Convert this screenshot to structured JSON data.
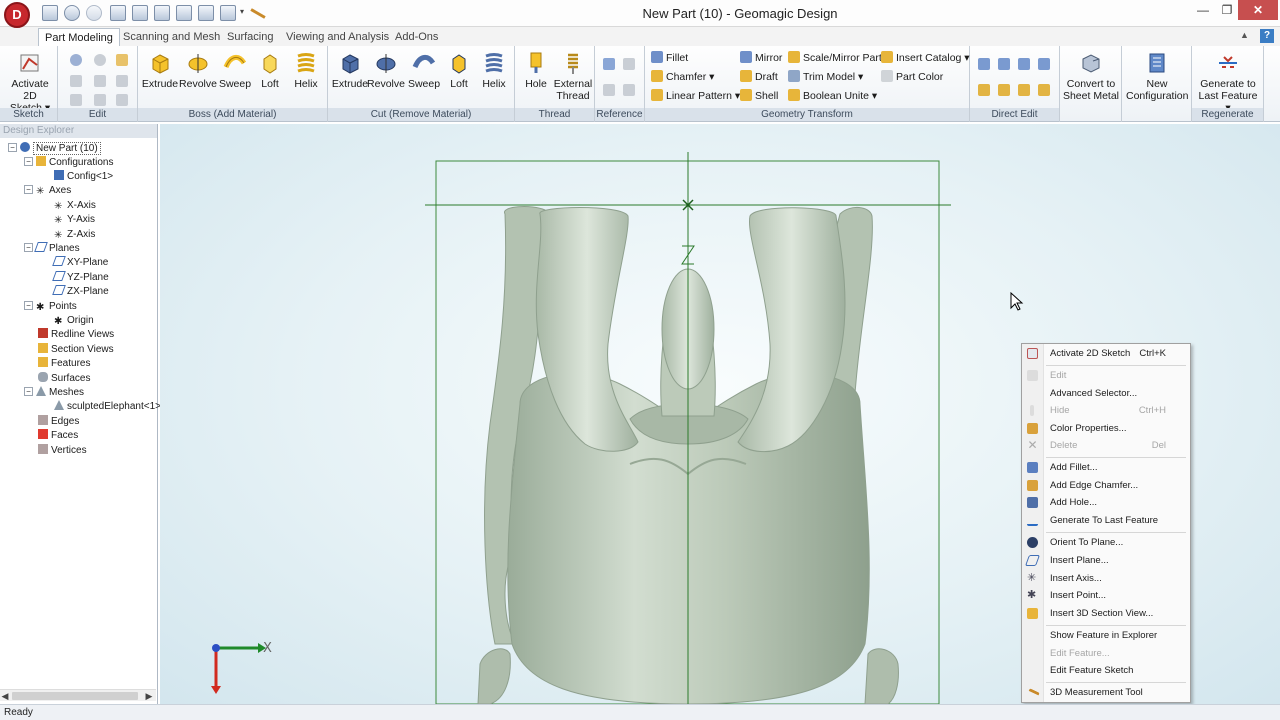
{
  "window": {
    "title": "New Part (10) - Geomagic Design"
  },
  "app_logo": {
    "letter": "D"
  },
  "tabs": [
    "Part Modeling",
    "Scanning and Mesh",
    "Surfacing",
    "Viewing and Analysis",
    "Add-Ons"
  ],
  "ribbon": {
    "groups": {
      "sketch": "Sketch",
      "edit": "Edit",
      "boss": "Boss (Add Material)",
      "cut": "Cut (Remove Material)",
      "thread": "Thread",
      "reference": "Reference",
      "geometry": "Geometry Transform",
      "direct_edit": "Direct Edit",
      "regenerate": "Regenerate"
    },
    "activate_sketch": [
      "Activate",
      "2D Sketch ▾"
    ],
    "boss": [
      "Extrude",
      "Revolve",
      "Sweep",
      "Loft",
      "Helix"
    ],
    "cut": [
      "Extrude",
      "Revolve",
      "Sweep",
      "Loft",
      "Helix"
    ],
    "thread": [
      "Hole",
      "External",
      "Thread"
    ],
    "geometry": {
      "fillet": "Fillet",
      "chamfer": "Chamfer ▾",
      "linear_pattern": "Linear Pattern ▾",
      "mirror": "Mirror",
      "draft": "Draft",
      "shell": "Shell",
      "scale_mirror": "Scale/Mirror Part",
      "trim_model": "Trim Model ▾",
      "boolean_unite": "Boolean Unite ▾",
      "insert_catalog": "Insert Catalog ▾",
      "part_color": "Part Color"
    },
    "convert": [
      "Convert to",
      "Sheet Metal"
    ],
    "new_config": [
      "New",
      "Configuration"
    ],
    "generate": [
      "Generate to",
      "Last Feature ▾"
    ]
  },
  "explorer": {
    "title": "Design Explorer",
    "root": "New Part (10)",
    "nodes": [
      "Configurations",
      "Config<1>",
      "Axes",
      "X-Axis",
      "Y-Axis",
      "Z-Axis",
      "Planes",
      "XY-Plane",
      "YZ-Plane",
      "ZX-Plane",
      "Points",
      "Origin",
      "Redline Views",
      "Section Views",
      "Features",
      "Surfaces",
      "Meshes",
      "sculptedElephant<1>",
      "Edges",
      "Faces",
      "Vertices"
    ]
  },
  "triad": {
    "x_label": "X"
  },
  "context_menu": {
    "items": [
      {
        "label": "Activate 2D Sketch",
        "shortcut": "Ctrl+K",
        "enabled": true
      },
      {
        "label": "Edit",
        "shortcut": "",
        "enabled": false
      },
      {
        "label": "Advanced Selector...",
        "shortcut": "",
        "enabled": true
      },
      {
        "label": "Hide",
        "shortcut": "Ctrl+H",
        "enabled": false
      },
      {
        "label": "Color Properties...",
        "shortcut": "",
        "enabled": true
      },
      {
        "label": "Delete",
        "shortcut": "Del",
        "enabled": false
      },
      {
        "label": "Add Fillet...",
        "shortcut": "",
        "enabled": true
      },
      {
        "label": "Add Edge Chamfer...",
        "shortcut": "",
        "enabled": true
      },
      {
        "label": "Add Hole...",
        "shortcut": "",
        "enabled": true
      },
      {
        "label": "Generate To Last Feature",
        "shortcut": "",
        "enabled": true
      },
      {
        "label": "Orient To Plane...",
        "shortcut": "",
        "enabled": true
      },
      {
        "label": "Insert Plane...",
        "shortcut": "",
        "enabled": true
      },
      {
        "label": "Insert Axis...",
        "shortcut": "",
        "enabled": true
      },
      {
        "label": "Insert Point...",
        "shortcut": "",
        "enabled": true
      },
      {
        "label": "Insert 3D Section View...",
        "shortcut": "",
        "enabled": true
      },
      {
        "label": "Show Feature in Explorer",
        "shortcut": "",
        "enabled": true
      },
      {
        "label": "Edit Feature...",
        "shortcut": "",
        "enabled": false
      },
      {
        "label": "Edit Feature Sketch",
        "shortcut": "",
        "enabled": true
      },
      {
        "label": "3D Measurement Tool",
        "shortcut": "",
        "enabled": true
      }
    ]
  },
  "status": {
    "text": "Ready"
  },
  "colors": {
    "accent_tab": "#ffffff",
    "model_fill": "#c3d0c1",
    "sketch_line": "#2b7a2b",
    "close_button": "#c74f4f"
  }
}
